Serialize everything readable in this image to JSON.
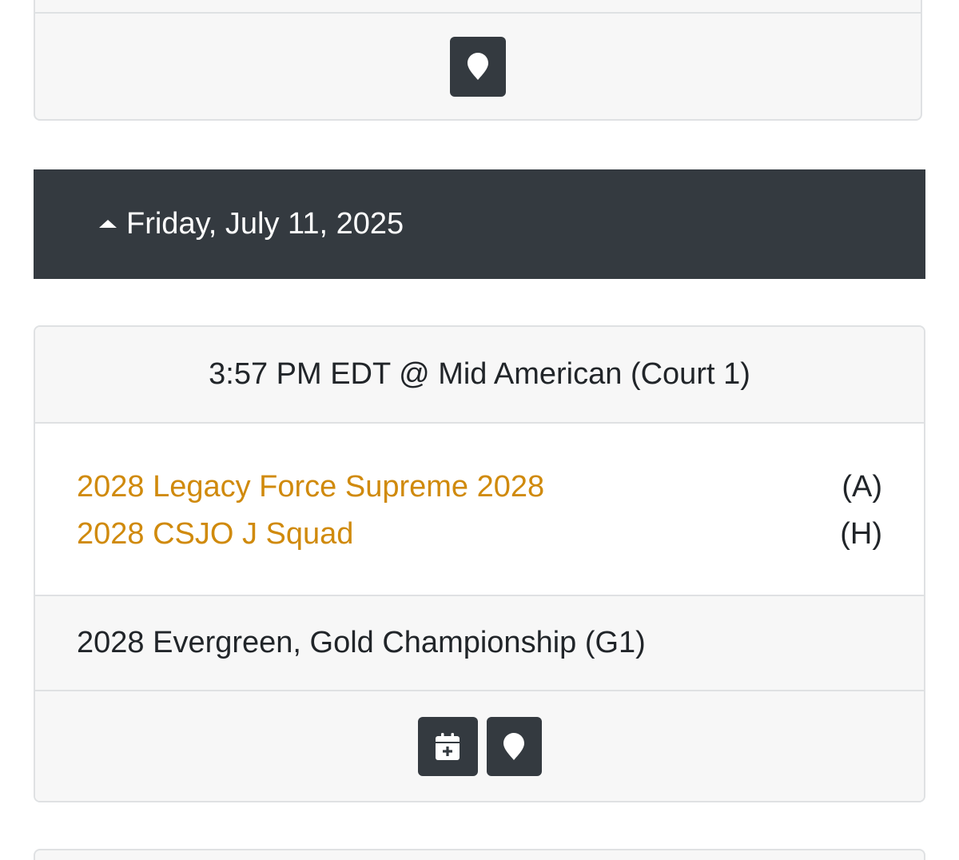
{
  "day": {
    "label": "Friday, July 11, 2025"
  },
  "match": {
    "header": "3:57 PM EDT @ Mid American (Court 1)",
    "teams": [
      {
        "name": "2028 Legacy Force Supreme 2028",
        "side": "(A)"
      },
      {
        "name": "2028 CSJO J Squad",
        "side": "(H)"
      }
    ],
    "event": "2028 Evergreen, Gold Championship (G1)"
  },
  "icons": {
    "location": "map-marker-icon",
    "calendar_add": "calendar-plus-icon",
    "collapse": "caret-up-icon"
  },
  "colors": {
    "header_bg": "#343a40",
    "team_link": "#d08a0c",
    "card_bg": "#f7f7f7",
    "border": "#dfe1e3"
  }
}
